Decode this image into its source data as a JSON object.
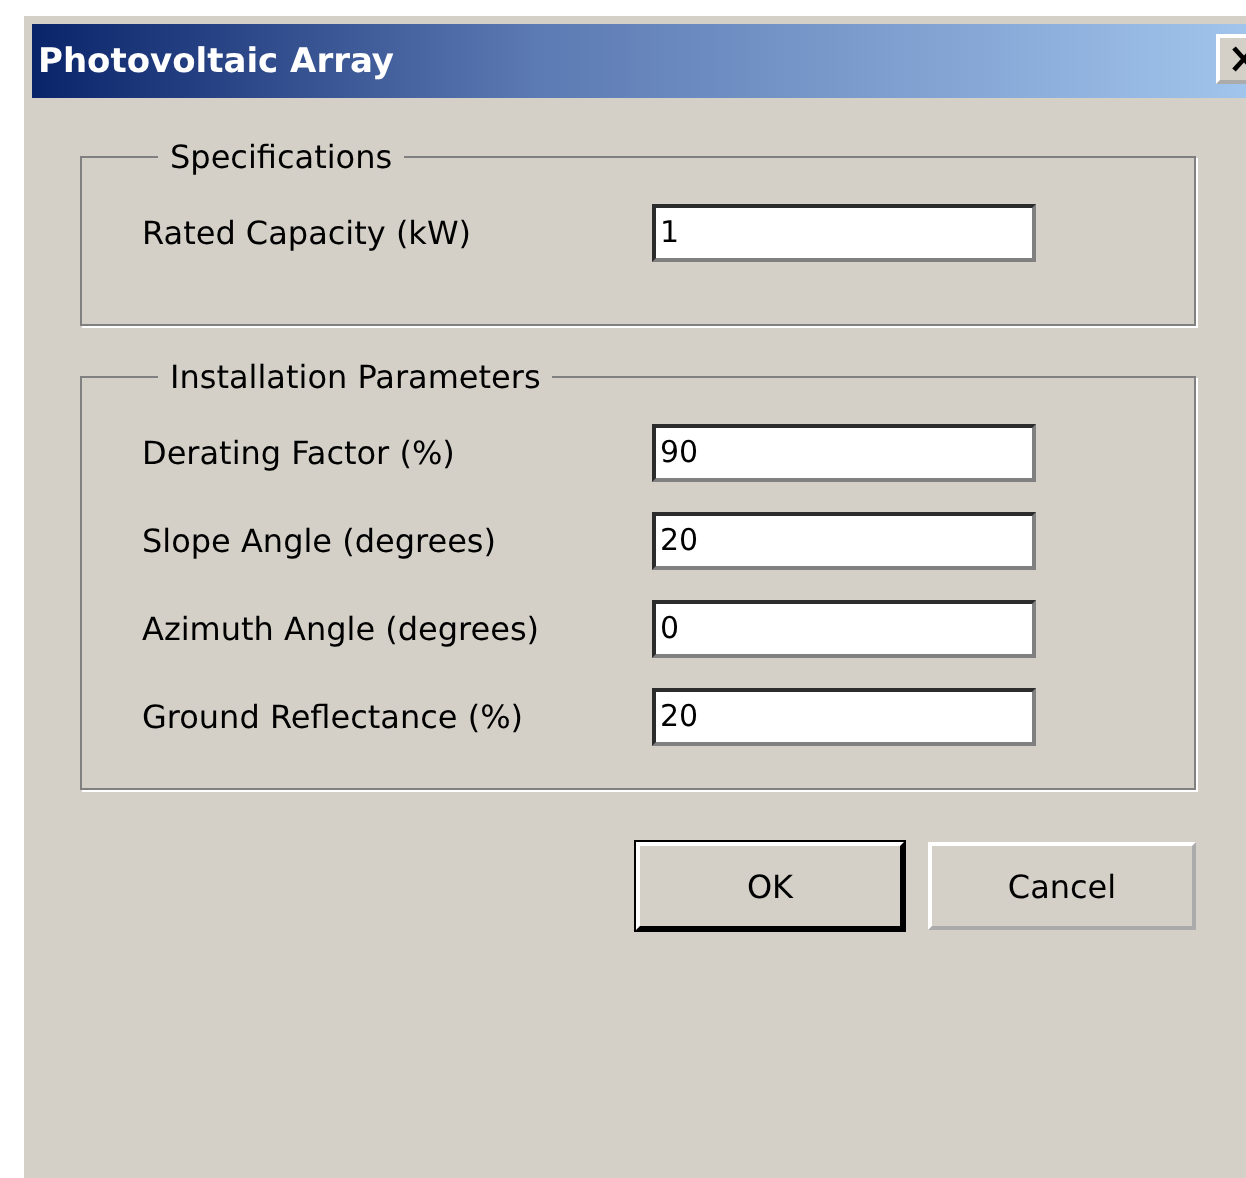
{
  "window": {
    "title": "Photovoltaic Array"
  },
  "groups": [
    {
      "title": "Specifications",
      "fields": [
        {
          "label": "Rated Capacity (kW)",
          "value": "1"
        }
      ]
    },
    {
      "title": "Installation Parameters",
      "fields": [
        {
          "label": "Derating Factor (%)",
          "value": "90"
        },
        {
          "label": "Slope Angle (degrees)",
          "value": "20"
        },
        {
          "label": "Azimuth Angle (degrees)",
          "value": "0"
        },
        {
          "label": "Ground Reflectance (%)",
          "value": "20"
        }
      ]
    }
  ],
  "buttons": [
    {
      "label": "OK",
      "default": true
    },
    {
      "label": "Cancel",
      "default": false
    }
  ]
}
